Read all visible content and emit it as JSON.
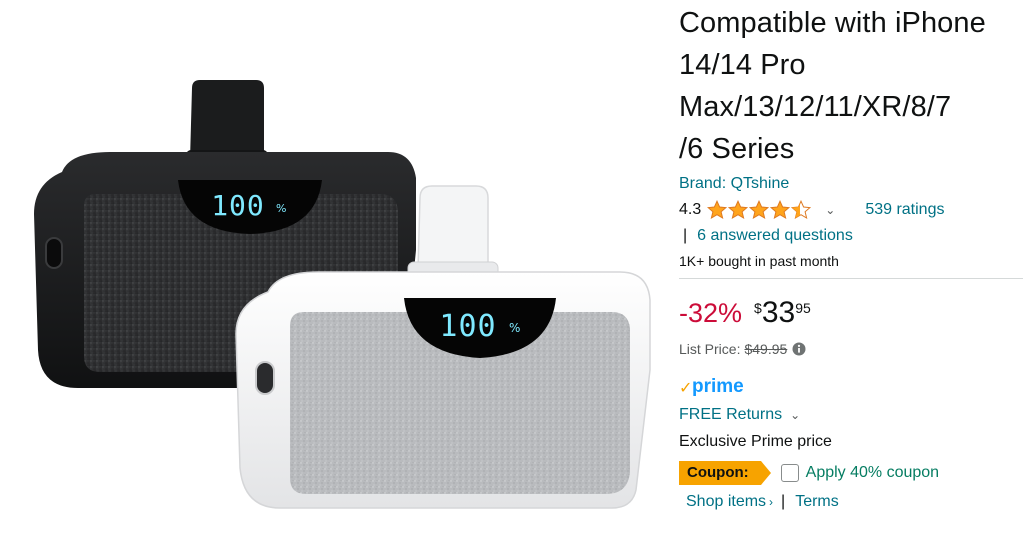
{
  "product": {
    "image_alt": "Two mini portable power banks, black and white, each showing 100%",
    "display_readout": "100",
    "display_unit": "%"
  },
  "title_lines": [
    "Compatible with iPhone",
    "14/14 Pro",
    "Max/13/12/11/XR/8/7",
    "/6 Series"
  ],
  "brand": "Brand: QTshine",
  "rating": {
    "value": "4.3",
    "stars": 4.3,
    "ratings_count": "539 ratings",
    "qa_separator": "|",
    "answered": "6 answered questions"
  },
  "bought": "1K+ bought in past month",
  "price": {
    "discount": "-32%",
    "symbol": "$",
    "whole": "33",
    "fraction": "95",
    "list_label": "List Price:",
    "list_value": "$49.95"
  },
  "prime": {
    "logo_check": "✓",
    "logo_text": "prime",
    "free_returns": "FREE Returns",
    "exclusive": "Exclusive Prime price"
  },
  "coupon": {
    "badge": "Coupon:",
    "label": "Apply 40% coupon",
    "checked": false
  },
  "links": {
    "shop_items": "Shop items",
    "shop_arrow": "›",
    "separator": "|",
    "terms": "Terms"
  },
  "colors": {
    "link": "#007185",
    "discount": "#cc0c39",
    "star": "#ffa41c",
    "prime": "#1399ff",
    "coupon_badge": "#f7a300",
    "coupon_text": "#067d62",
    "lcd_digits": "#7fe9ff"
  }
}
